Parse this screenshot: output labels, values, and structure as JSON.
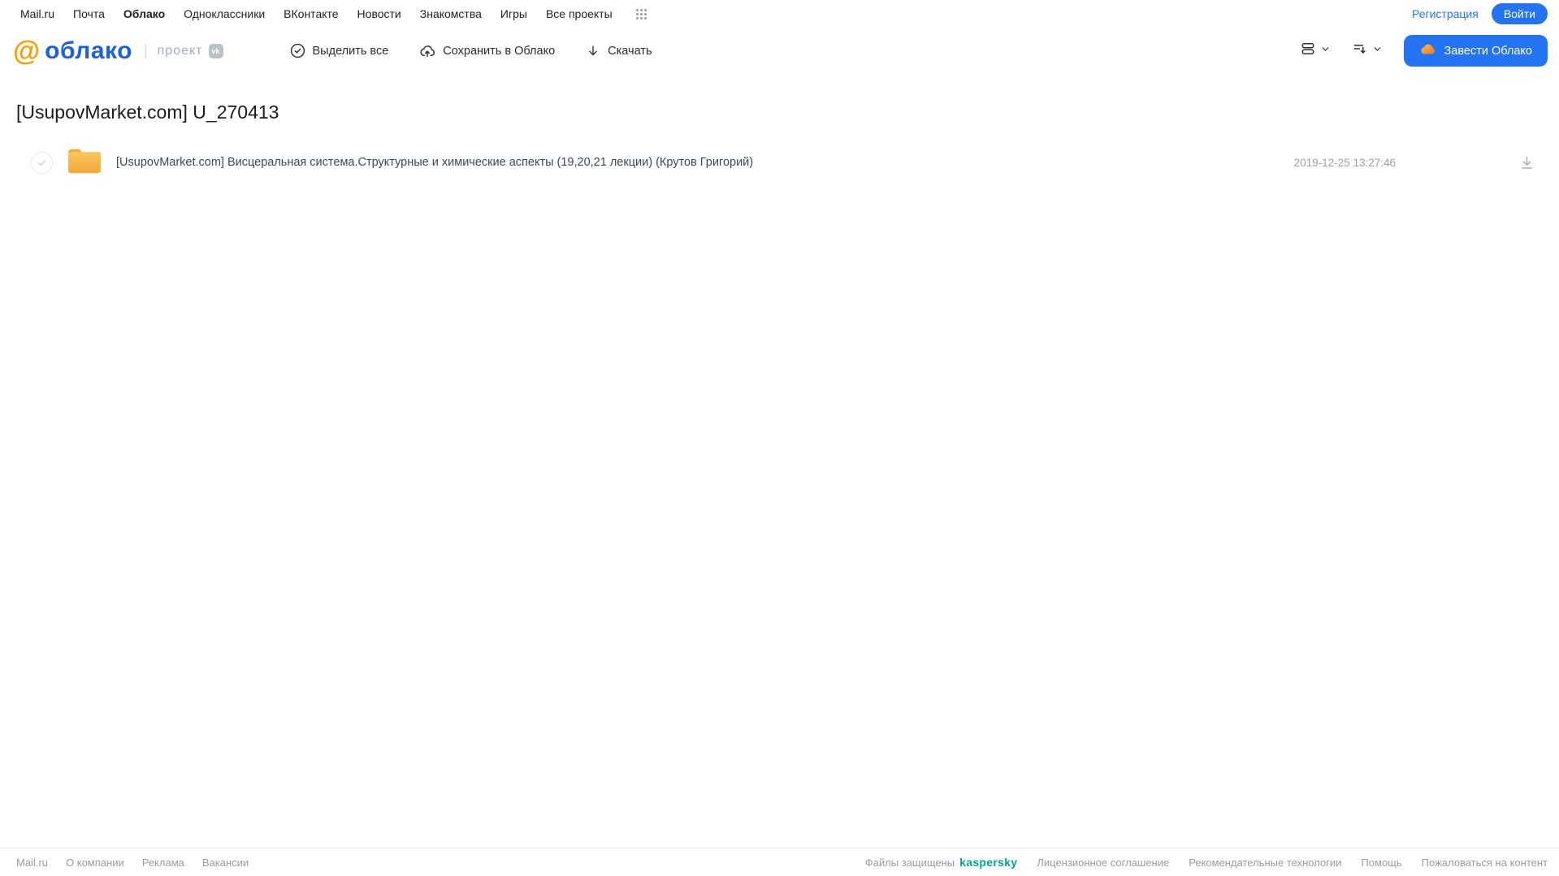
{
  "topbar": {
    "links": [
      "Mail.ru",
      "Почта",
      "Облако",
      "Одноклассники",
      "ВКонтакте",
      "Новости",
      "Знакомства",
      "Игры",
      "Все проекты"
    ],
    "active_link": "Облако",
    "register_label": "Регистрация",
    "login_label": "Войти"
  },
  "header": {
    "logo_at": "@",
    "logo_text": "облако",
    "project_label": "проект",
    "vk_badge": "vk",
    "toolbar": {
      "select_all": "Выделить все",
      "save_to_cloud": "Сохранить в Облако",
      "download": "Скачать"
    },
    "get_cloud_label": "Завести Облако"
  },
  "page": {
    "title": "[UsupovMarket.com] U_270413"
  },
  "files": [
    {
      "type": "folder",
      "name": "[UsupovMarket.com] Висцеральная система.Структурные и химические аспекты (19,20,21 лекции) (Крутов Григорий)",
      "modified": "2019-12-25 13:27:46"
    }
  ],
  "footer": {
    "left_links": [
      "Mail.ru",
      "О компании",
      "Реклама",
      "Вакансии"
    ],
    "protected_label": "Файлы защищены",
    "kaspersky_label": "kaspersky",
    "right_links": [
      "Лицензионное соглашение",
      "Рекомендательные технологии",
      "Помощь",
      "Пожаловаться на контент"
    ]
  },
  "colors": {
    "accent_blue": "#2374f2",
    "logo_orange": "#ff9e00",
    "logo_blue": "#1d61e0",
    "folder_yellow": "#f6b844",
    "kaspersky_green": "#00a88e",
    "muted_gray": "#9b9b9b"
  }
}
